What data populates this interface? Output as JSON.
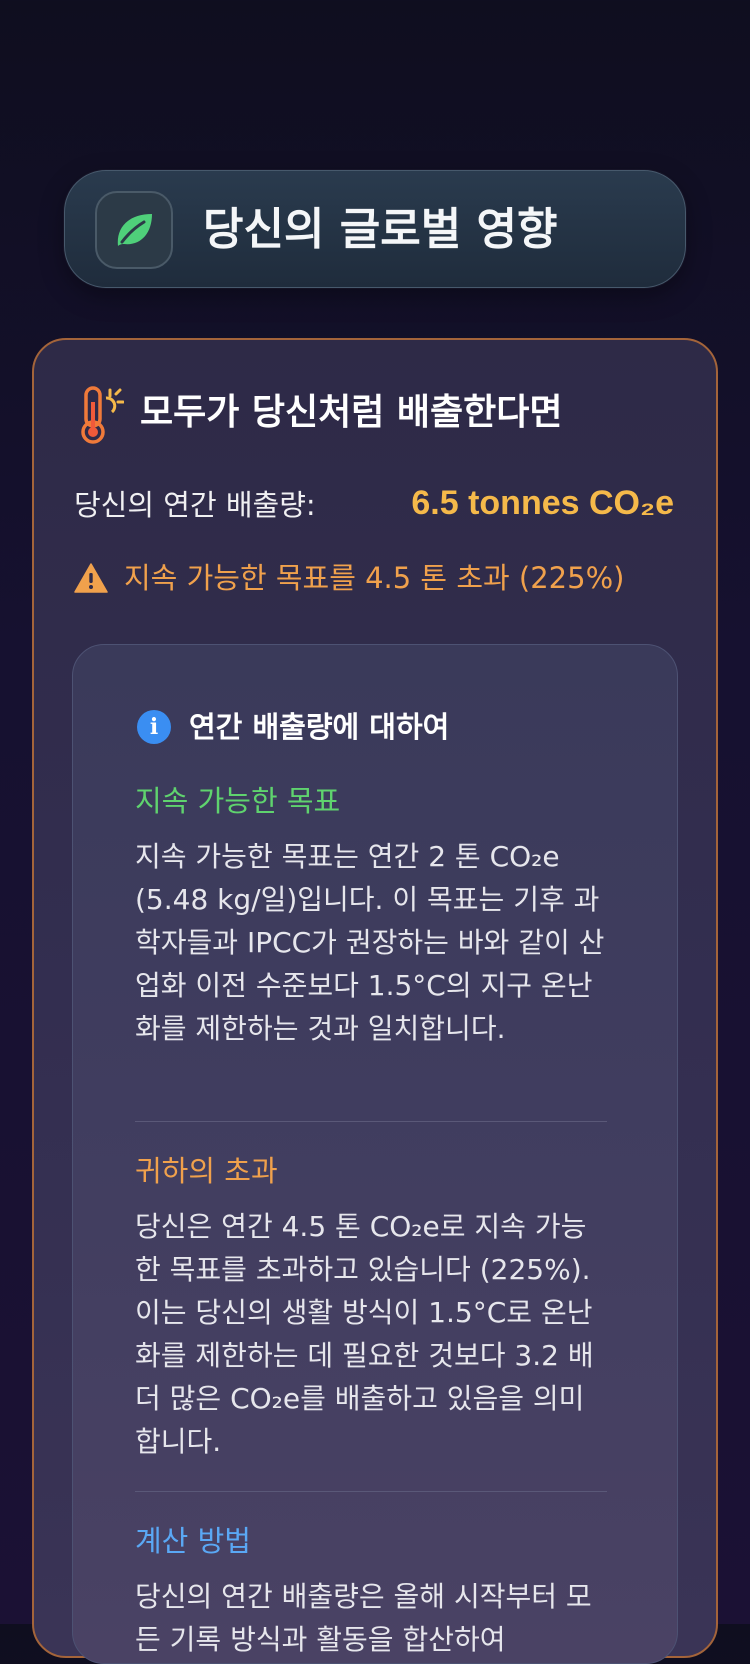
{
  "header": {
    "title": "당신의 글로벌 영향",
    "icon": "leaf-icon"
  },
  "impact": {
    "title": "모두가 당신처럼 배출한다면",
    "icon": "thermometer-sun-icon",
    "emissions_label": "당신의 연간 배출량:",
    "emissions_value": "6.5 tonnes CO₂e",
    "warning_text": "지속 가능한 목표를 4.5 톤 초과 (225%)",
    "warning_icon": "warning-icon"
  },
  "info": {
    "title": "연간 배출량에 대하여",
    "icon": "info-icon",
    "sections": [
      {
        "title": "지속 가능한 목표",
        "title_color": "#5fd36e",
        "body": "지속 가능한 목표는 연간 2 톤 CO₂e (5.48 kg/일)입니다. 이 목표는 기후 과학자들과 IPCC가 권장하는 바와 같이 산업화 이전 수준보다 1.5°C의 지구 온난화를 제한하는 것과 일치합니다."
      },
      {
        "title": "귀하의 초과",
        "title_color": "#f0a14c",
        "body": "당신은 연간 4.5 톤 CO₂e로 지속 가능한 목표를 초과하고 있습니다 (225%). 이는 당신의 생활 방식이 1.5°C로 온난화를 제한하는 데 필요한 것보다 3.2 배 더 많은 CO₂e를 배출하고 있음을 의미합니다."
      },
      {
        "title": "계산 방법",
        "title_color": "#5aa8f5",
        "body": "당신의 연간 배출량은 올해 시작부터 모든 기록 방식과 활동을 합산하여"
      }
    ]
  },
  "colors": {
    "background": "#120f26",
    "accent_orange": "#f5b94a",
    "warning_orange": "#f0a14c",
    "green": "#5fd36e",
    "blue": "#5aa8f5"
  }
}
